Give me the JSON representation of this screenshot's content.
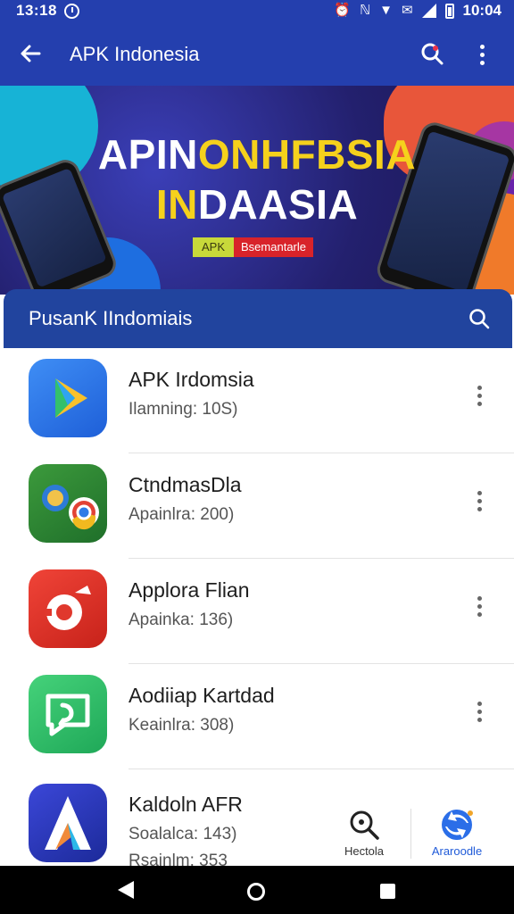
{
  "status_bar": {
    "time": "13:18",
    "clock_right": "10:04"
  },
  "app_bar": {
    "title": "APK Indonesia"
  },
  "banner": {
    "line1_white": "APIN",
    "line1_yellow": "ONHFBSIA",
    "line2_yellow": "IN",
    "line2_white": "DAASIA",
    "tag_left": "APK",
    "tag_right": "Bsemantarle"
  },
  "section": {
    "label": "PusanK IIndomiais"
  },
  "apps": [
    {
      "name": "APK Irdomsia",
      "sub": "Ilamning: 10S)",
      "icon": "play-store-icon"
    },
    {
      "name": "CtndmasDla",
      "sub": "Apainlra: 200)",
      "icon": "chrome-icon"
    },
    {
      "name": "Applora Flian",
      "sub": "Apainka: 136)",
      "icon": "camera-app-icon"
    },
    {
      "name": "Aodiiap Kartdad",
      "sub": "Keainlra: 308)",
      "icon": "chat-app-icon"
    },
    {
      "name": "Kaldoln AFR",
      "sub": "Soalalca: 143)",
      "sub2": "Rsainlm: 353",
      "icon": "arrow-app-icon"
    }
  ],
  "bottom_actions": {
    "left_label": "Hectola",
    "right_label": "Araroodle"
  },
  "colors": {
    "primary": "#243fae",
    "section_header": "#21449e",
    "banner_yellow": "#f5d11c",
    "accent_red": "#d8232a"
  }
}
